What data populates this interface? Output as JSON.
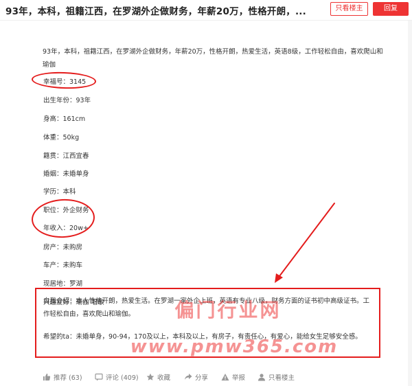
{
  "header": {
    "title": "93年，本科，祖籍江西，在罗湖外企做财务，年薪20万，性格开朗，...",
    "only_owner_label": "只看楼主",
    "reply_label": "回复"
  },
  "post": {
    "intro": "93年，本科，祖籍江西，在罗湖外企做财务，年薪20万，性格开朗，热爱生活，英语8级，工作轻松自由，喜欢爬山和瑜伽",
    "fields": [
      "幸福号：3145",
      "出生年份：93年",
      "身高：161cm",
      "体重：50kg",
      "籍贯：江西宜春",
      "婚姻：未婚单身",
      "学历：本科",
      "职位：外企财务",
      "年收入：20w+",
      "房产：未购房",
      "车产：未购车",
      "现居地：罗湖",
      "兴趣爱好：瑜伽 唱歌"
    ],
    "self_intro": "自我介绍：本人性格开朗，热爱生活。在罗湖一家外企上班，英语有专业八级，财务方面的证书初中高级证书。工作轻松自由，喜欢爬山和瑜伽。",
    "expectation": "希望的ta：未婚单身，90-94，170及以上，本科及以上，有房子，有责任心，有爱心，能给女生足够安全感。"
  },
  "watermark": {
    "line1": "偏门行业网",
    "line2": "www.pmw365.com"
  },
  "actions": {
    "recommend": "推荐 (63)",
    "comment": "评论 (409)",
    "favorite": "收藏",
    "share": "分享",
    "report": "举报",
    "only_owner": "只看楼主"
  },
  "colors": {
    "accent": "#e33333",
    "annotation": "#e41c1c"
  }
}
